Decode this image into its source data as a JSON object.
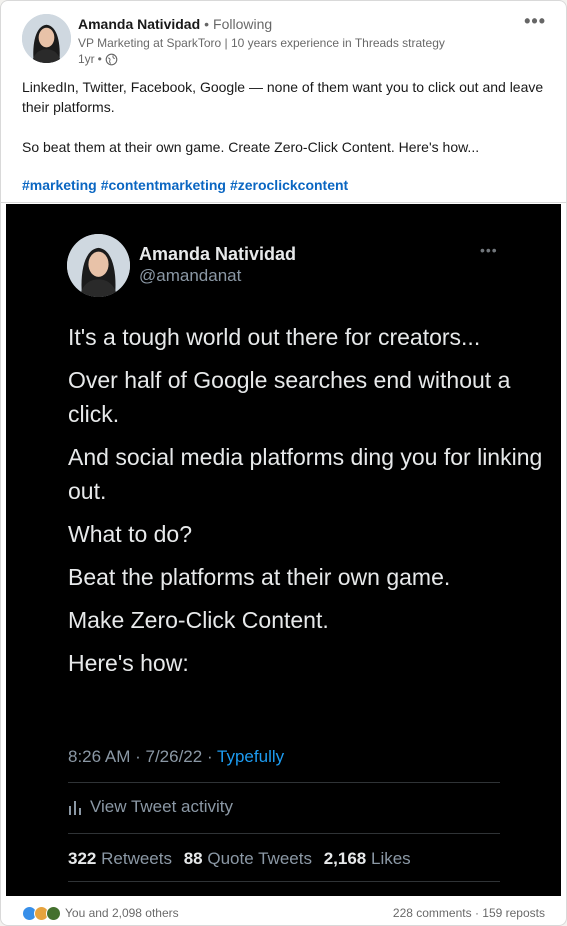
{
  "post": {
    "author": "Amanda Natividad",
    "follow_status": "Following",
    "headline": "VP Marketing at SparkToro | 10 years experience in Threads strategy",
    "time": "1yr",
    "text_line1": "LinkedIn, Twitter, Facebook, Google — none of them want you to click out and leave their platforms.",
    "text_line2": "So beat them at their own game. Create Zero-Click Content. Here's how...",
    "hashtags": [
      "#marketing",
      "#contentmarketing",
      "#zeroclickcontent"
    ]
  },
  "tweet": {
    "name": "Amanda Natividad",
    "handle": "@amandanat",
    "lines": [
      "It's a tough world out there for creators...",
      "Over half of Google searches end without a click.",
      "And social media platforms ding you for linking out.",
      "What to do?",
      "Beat the platforms at their own game.",
      "Make Zero-Click Content.",
      "Here's how:"
    ],
    "time": "8:26 AM",
    "date": "7/26/22",
    "source": "Typefully",
    "activity_label": "View Tweet activity",
    "retweets_count": "322",
    "retweets_label": "Retweets",
    "quotes_count": "88",
    "quotes_label": "Quote Tweets",
    "likes_count": "2,168",
    "likes_label": "Likes"
  },
  "social": {
    "reactions_text": "You and 2,098 others",
    "comments": "228 comments",
    "reposts": "159 reposts"
  },
  "colors": {
    "link_blue": "#0a66c2",
    "twitter_blue": "#1d9bf0",
    "tweet_bg": "#000000"
  },
  "icons": [
    "globe-icon",
    "more-icon",
    "bars-icon",
    "like-icon",
    "celebrate-icon",
    "support-icon"
  ]
}
